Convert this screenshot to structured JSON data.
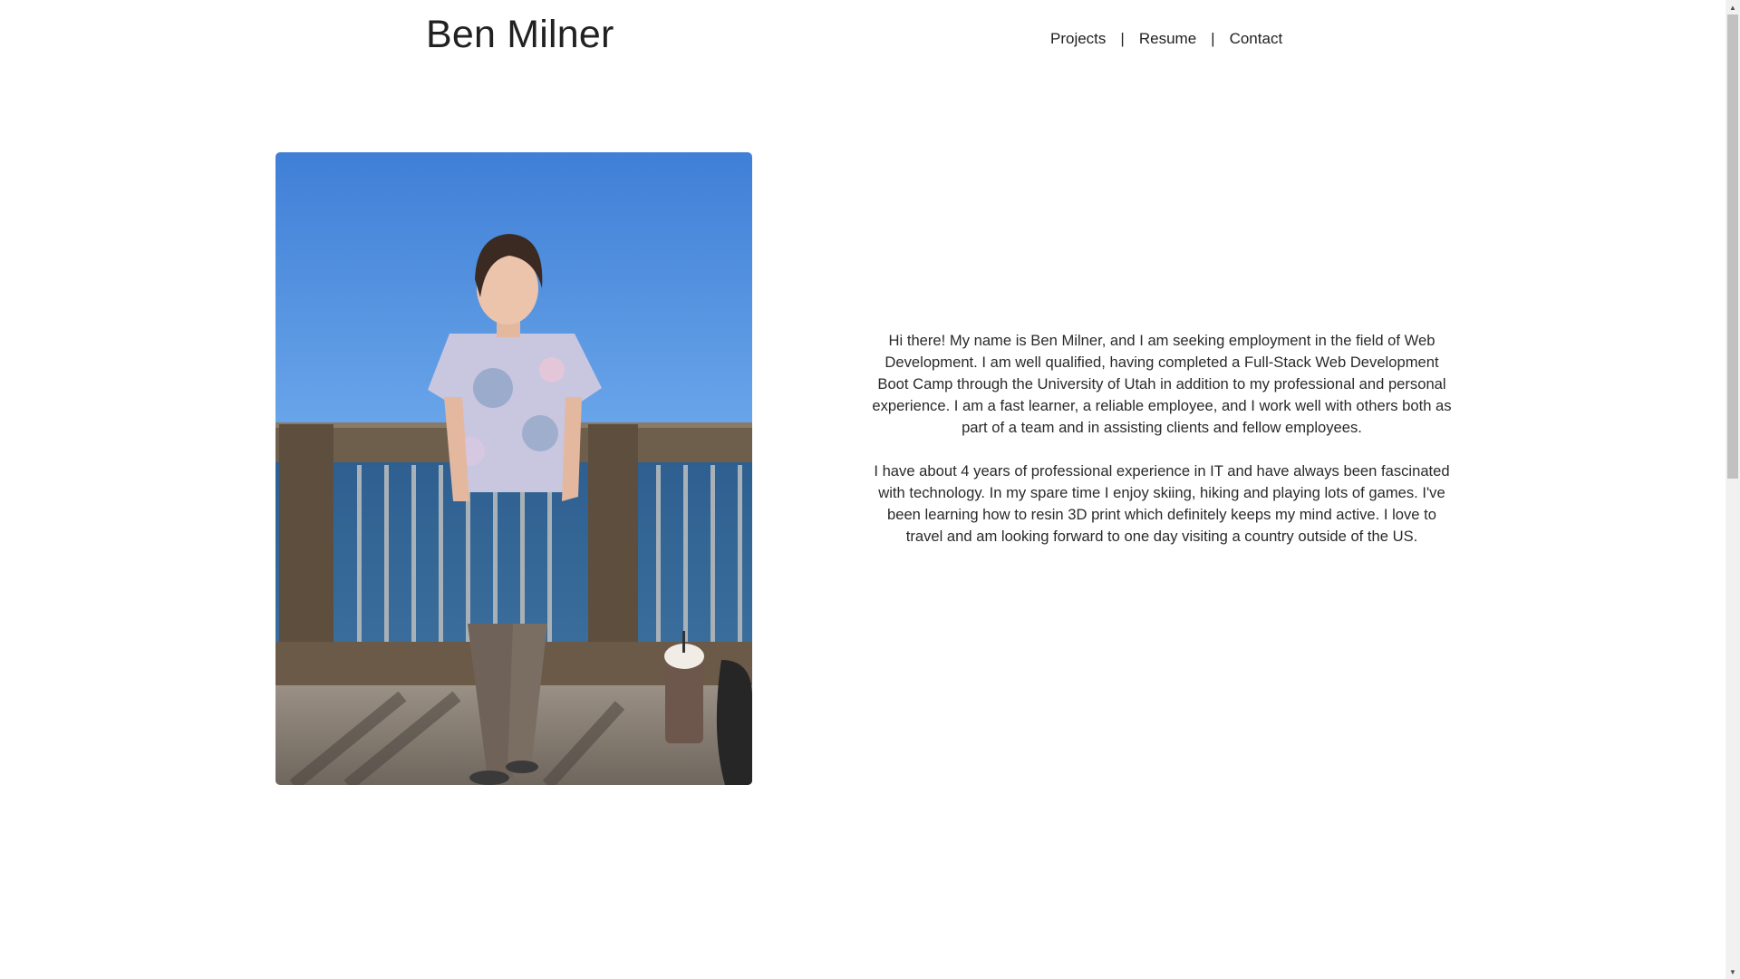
{
  "header": {
    "title": "Ben Milner",
    "nav": [
      {
        "label": "Projects"
      },
      {
        "label": "Resume"
      },
      {
        "label": "Contact"
      }
    ],
    "separator": "|"
  },
  "main": {
    "bio_paragraphs": [
      "Hi there! My name is Ben Milner, and I am seeking employment in the field of Web Development. I am well qualified, having completed a Full-Stack Web Development Boot Camp through the University of Utah in addition to my professional and personal experience. I am a fast learner, a reliable employee, and I work well with others both as part of a team and in assisting clients and fellow employees.",
      "I have about 4 years of professional experience in IT and have always been fascinated with technology. In my spare time I enjoy skiing, hiking and playing lots of games. I've been learning how to resin 3D print which definitely keeps my mind active. I love to travel and am looking forward to one day visiting a country outside of the US."
    ]
  },
  "colors": {
    "sky": "#4a8fdc",
    "water": "#2f5d86",
    "railing": "#6b5a47",
    "deck": "#8a7f72",
    "text": "#222222"
  },
  "icons": {
    "scroll_up": "triangle-up-icon",
    "scroll_down": "triangle-down-icon"
  }
}
